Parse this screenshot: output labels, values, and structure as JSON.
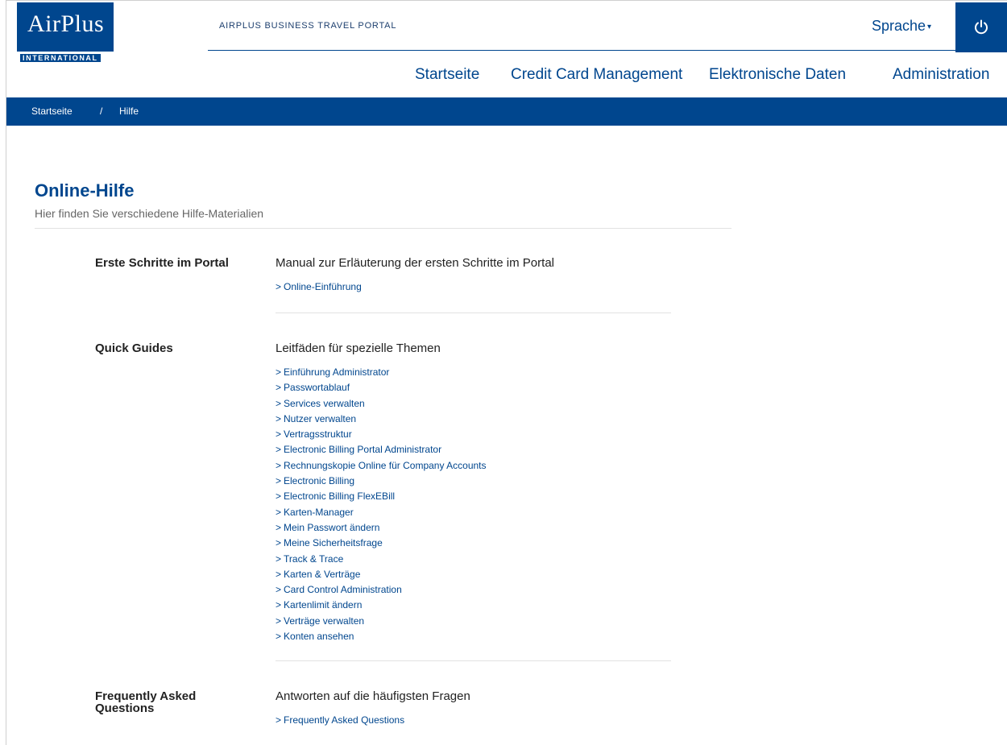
{
  "header": {
    "logo_text": "AirPlus",
    "logo_subtext": "INTERNATIONAL",
    "portal_title": "AIRPLUS BUSINESS TRAVEL PORTAL",
    "language_label": "Sprache",
    "power_icon": "power-icon"
  },
  "nav": {
    "items": [
      {
        "label": "Startseite"
      },
      {
        "label": "Credit Card Management"
      },
      {
        "label": "Elektronische Daten"
      },
      {
        "label": "Administration"
      }
    ]
  },
  "breadcrumb": {
    "home": "Startseite",
    "separator": "/",
    "current": "Hilfe"
  },
  "page": {
    "title": "Online-Hilfe",
    "subtitle": "Hier finden Sie verschiedene Hilfe-Materialien"
  },
  "sections": [
    {
      "label": "Erste Schritte im Portal",
      "description": "Manual zur Erläuterung der ersten Schritte im Portal",
      "links": [
        "Online-Einführung"
      ]
    },
    {
      "label": "Quick Guides",
      "description": "Leitfäden für spezielle Themen",
      "links": [
        "Einführung Administrator",
        "Passwortablauf",
        "Services verwalten",
        "Nutzer verwalten",
        "Vertragsstruktur",
        "Electronic Billing Portal Administrator",
        "Rechnungskopie Online für Company Accounts",
        "Electronic Billing",
        "Electronic Billing FlexEBill",
        "Karten-Manager",
        "Mein Passwort ändern",
        "Meine Sicherheitsfrage",
        "Track & Trace",
        "Karten & Verträge",
        "Card Control Administration",
        "Kartenlimit ändern",
        "Verträge verwalten",
        "Konten ansehen"
      ]
    },
    {
      "label": "Frequently Asked Questions",
      "description": "Antworten auf die häufigsten Fragen",
      "links": [
        "Frequently Asked Questions"
      ]
    }
  ],
  "link_chevron": ">",
  "colors": {
    "brand_blue": "#00468e",
    "text": "#222222",
    "muted": "#666666",
    "divider": "#e2e2e2"
  }
}
